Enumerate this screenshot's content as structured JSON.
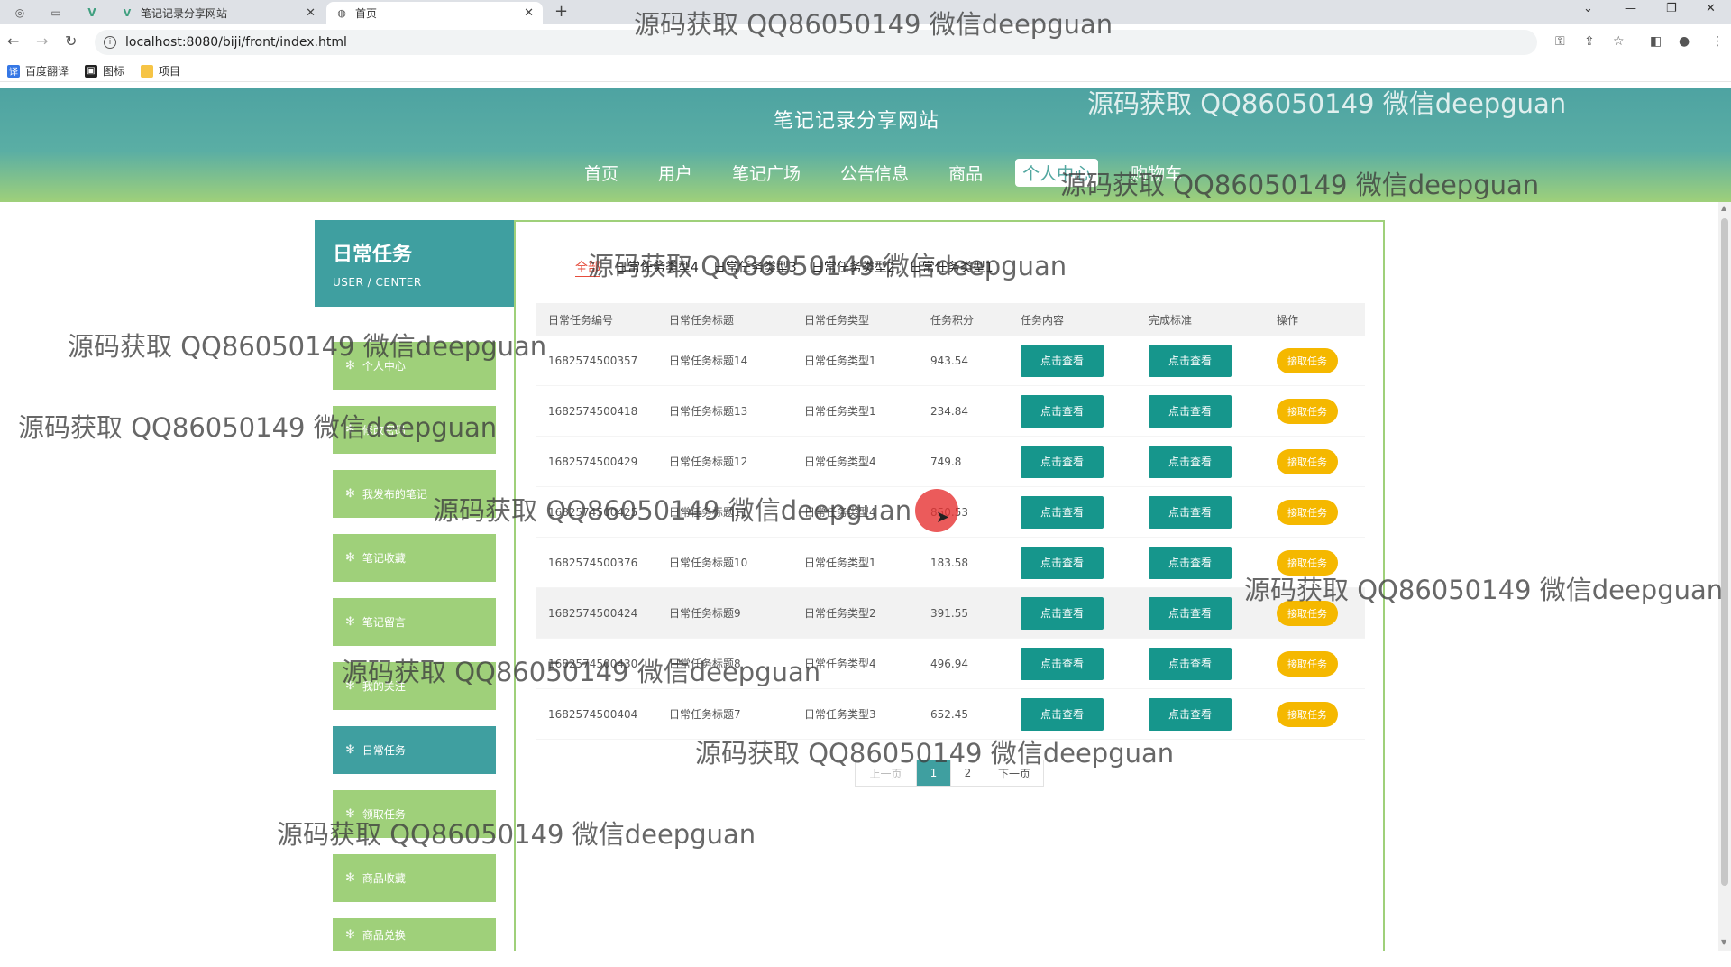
{
  "browser": {
    "tabs": [
      {
        "title": "笔记记录分享网站",
        "active": false
      },
      {
        "title": "首页",
        "active": true
      }
    ],
    "url": "localhost:8080/biji/front/index.html",
    "bookmarks": [
      "百度翻译",
      "图标",
      "项目"
    ]
  },
  "header": {
    "site_title": "笔记记录分享网站",
    "nav": [
      "首页",
      "用户",
      "笔记广场",
      "公告信息",
      "商品",
      "个人中心",
      "购物车"
    ],
    "active_nav": "个人中心"
  },
  "sidebar": {
    "title": "日常任务",
    "subtitle": "USER / CENTER",
    "items": [
      {
        "label": "个人中心"
      },
      {
        "label": "修改密码"
      },
      {
        "label": "我发布的笔记"
      },
      {
        "label": "笔记收藏"
      },
      {
        "label": "笔记留言"
      },
      {
        "label": "我的关注"
      },
      {
        "label": "日常任务",
        "active": true
      },
      {
        "label": "领取任务"
      },
      {
        "label": "商品收藏"
      },
      {
        "label": "商品兑换"
      }
    ]
  },
  "main": {
    "filter_tabs": [
      "全部",
      "日常任务类型4",
      "日常任务类型3",
      "日常任务类型2",
      "日常任务类型1"
    ],
    "active_filter": "全部",
    "table": {
      "headers": [
        "日常任务编号",
        "日常任务标题",
        "日常任务类型",
        "任务积分",
        "任务内容",
        "完成标准",
        "操作"
      ],
      "view_label": "点击查看",
      "action_label": "接取任务",
      "rows": [
        {
          "id": "1682574500357",
          "title": "日常任务标题14",
          "type": "日常任务类型1",
          "points": "943.54"
        },
        {
          "id": "1682574500418",
          "title": "日常任务标题13",
          "type": "日常任务类型1",
          "points": "234.84"
        },
        {
          "id": "1682574500429",
          "title": "日常任务标题12",
          "type": "日常任务类型4",
          "points": "749.8"
        },
        {
          "id": "1682574500425",
          "title": "日常任务标题11",
          "type": "日常任务类型4",
          "points": "850.53"
        },
        {
          "id": "1682574500376",
          "title": "日常任务标题10",
          "type": "日常任务类型1",
          "points": "183.58"
        },
        {
          "id": "1682574500424",
          "title": "日常任务标题9",
          "type": "日常任务类型2",
          "points": "391.55"
        },
        {
          "id": "1682574500430",
          "title": "日常任务标题8",
          "type": "日常任务类型4",
          "points": "496.94"
        },
        {
          "id": "1682574500404",
          "title": "日常任务标题7",
          "type": "日常任务类型3",
          "points": "652.45"
        }
      ]
    },
    "pagination": {
      "prev": "上一页",
      "pages": [
        "1",
        "2"
      ],
      "current": "1",
      "next": "下一页"
    }
  },
  "watermark_text": "源码获取 QQ86050149 微信deepguan",
  "colors": {
    "teal": "#16968c",
    "sidebar_teal": "#3f9fa0",
    "green": "#9fd07a",
    "yellow": "#f5b800",
    "active_filter": "#e64c3c"
  }
}
